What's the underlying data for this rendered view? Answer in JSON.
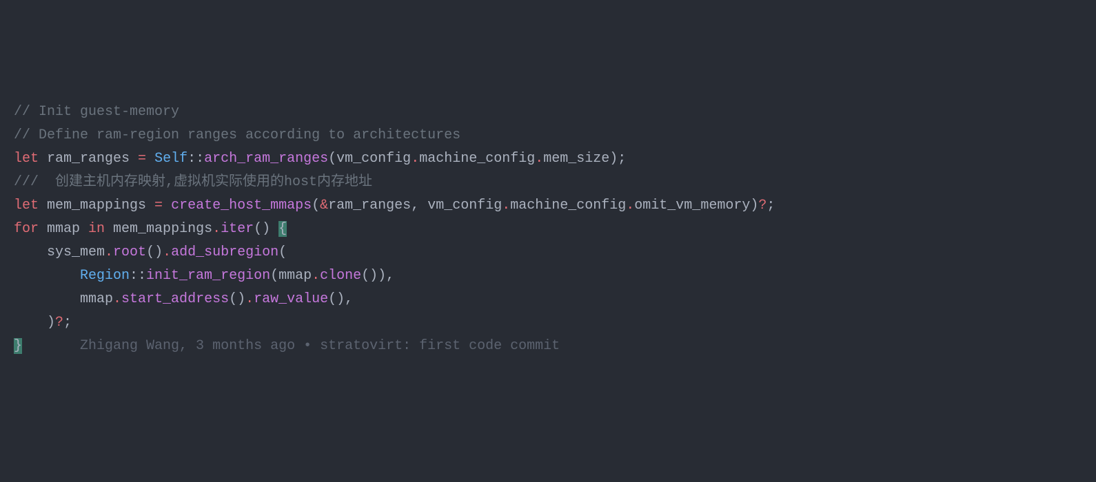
{
  "code": {
    "line1": {
      "comment": "// Init guest-memory"
    },
    "line2": {
      "comment": "// Define ram-region ranges according to architectures"
    },
    "line3": {
      "let": "let",
      "var": " ram_ranges ",
      "eq": "=",
      "space": " ",
      "type": "Self",
      "dcolon": "::",
      "func": "arch_ram_ranges",
      "lparen": "(",
      "arg1": "vm_config",
      "dot1": ".",
      "arg2": "machine_config",
      "dot2": ".",
      "arg3": "mem_size",
      "rparen": ")",
      "semi": ";"
    },
    "line4": {
      "comment": "///  创建主机内存映射,虚拟机实际使用的host内存地址"
    },
    "line5": {
      "let": "let",
      "var": " mem_mappings ",
      "eq": "=",
      "space": " ",
      "func": "create_host_mmaps",
      "lparen": "(",
      "amp": "&",
      "arg1": "ram_ranges",
      "comma": ", ",
      "arg2": "vm_config",
      "dot1": ".",
      "arg3": "machine_config",
      "dot2": ".",
      "arg4": "omit_vm_memory",
      "rparen": ")",
      "question": "?",
      "semi": ";"
    },
    "line6": {
      "for": "for",
      "var1": " mmap ",
      "in": "in",
      "var2": " mem_mappings",
      "dot": ".",
      "func": "iter",
      "lparen": "(",
      "rparen": ")",
      "space": " ",
      "lbrace": "{"
    },
    "line7": {
      "indent": "    ",
      "var": "sys_mem",
      "dot1": ".",
      "func1": "root",
      "parens1": "()",
      "dot2": ".",
      "func2": "add_subregion",
      "lparen": "("
    },
    "line8": {
      "indent": "        ",
      "type": "Region",
      "dcolon": "::",
      "func": "init_ram_region",
      "lparen": "(",
      "arg": "mmap",
      "dot": ".",
      "func2": "clone",
      "parens": "()",
      "rparen": ")",
      "comma": ","
    },
    "line9": {
      "indent": "        ",
      "var": "mmap",
      "dot1": ".",
      "func1": "start_address",
      "parens1": "()",
      "dot2": ".",
      "func2": "raw_value",
      "parens2": "()",
      "comma": ","
    },
    "line10": {
      "indent": "    ",
      "rparen": ")",
      "question": "?",
      "semi": ";"
    },
    "line11": {
      "rbrace": "}",
      "blame_spacer": "       ",
      "blame": "Zhigang Wang, 3 months ago • stratovirt: first code commit"
    }
  }
}
